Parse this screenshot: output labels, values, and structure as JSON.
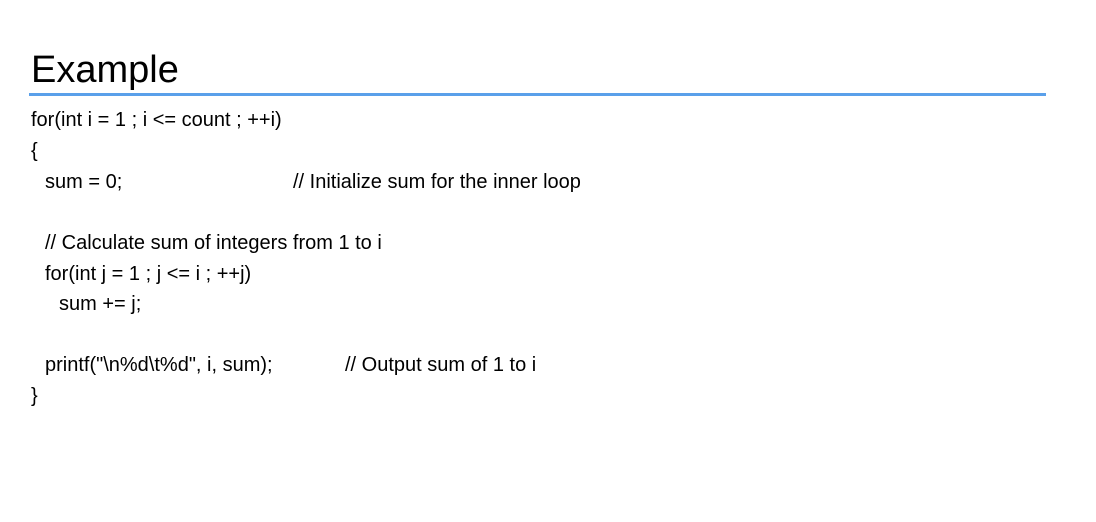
{
  "slide": {
    "title": "Example",
    "code": {
      "outer_for": "for(int i = 1 ; i <= count ; ++i)",
      "open_brace": "{",
      "sum_init": "sum = 0;",
      "sum_init_comment": "// Initialize sum for the inner loop",
      "calc_comment": "// Calculate sum of integers from 1 to i",
      "inner_for": "for(int j = 1 ; j <= i ; ++j)",
      "sum_add": "sum += j;",
      "printf": "printf(\"\\n%d\\t%d\", i, sum);",
      "printf_comment": "// Output sum of 1 to i",
      "close_brace": "}"
    },
    "accent_color": "#5aa0ea"
  }
}
